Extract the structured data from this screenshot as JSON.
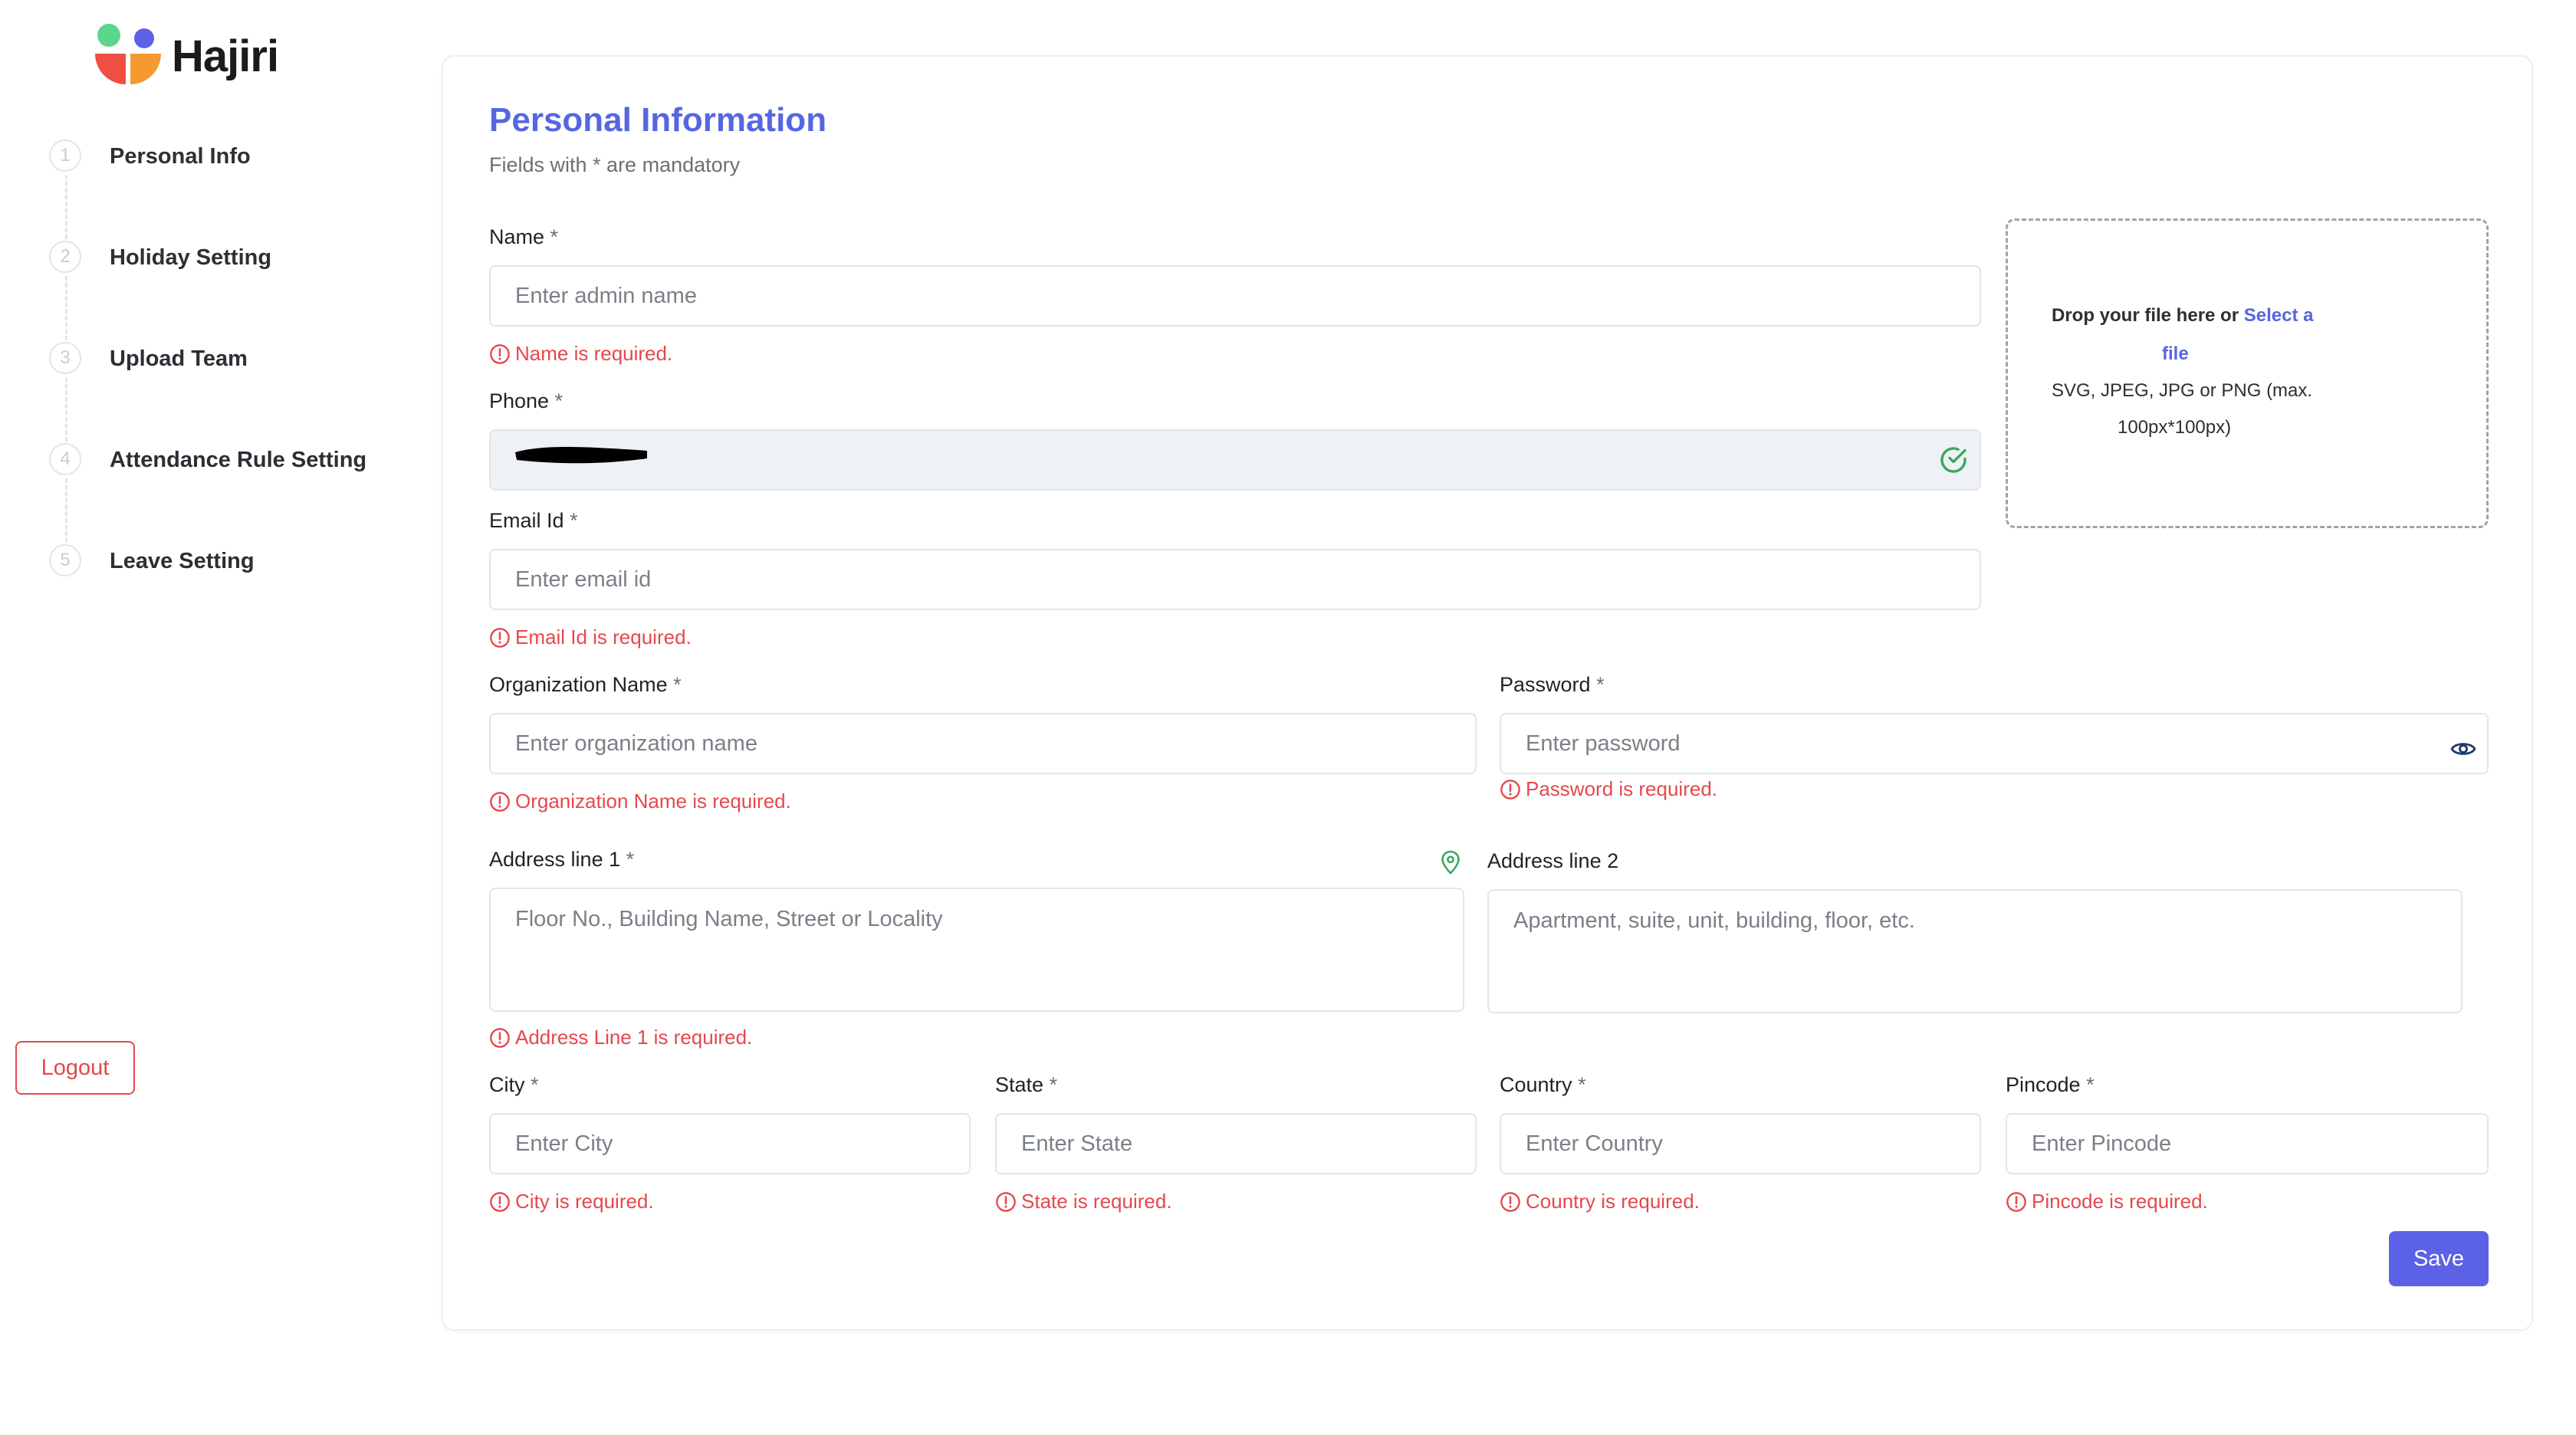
{
  "brand": {
    "name": "Hajiri",
    "colors": {
      "green": "#5bd68c",
      "purple": "#5b62e6",
      "red": "#ef4e43",
      "orange": "#f59a2e"
    }
  },
  "steps": [
    {
      "number": "1",
      "label": "Personal Info"
    },
    {
      "number": "2",
      "label": "Holiday Setting"
    },
    {
      "number": "3",
      "label": "Upload Team"
    },
    {
      "number": "4",
      "label": "Attendance Rule Setting"
    },
    {
      "number": "5",
      "label": "Leave Setting"
    }
  ],
  "logout_label": "Logout",
  "form": {
    "title": "Personal Information",
    "subtitle": "Fields with * are mandatory",
    "required_mark": "*",
    "name": {
      "label": "Name",
      "placeholder": "Enter admin name",
      "error": "Name is required."
    },
    "phone": {
      "label": "Phone",
      "value": ""
    },
    "email": {
      "label": "Email Id",
      "placeholder": "Enter email id",
      "error": "Email Id is required."
    },
    "organization": {
      "label": "Organization Name",
      "placeholder": "Enter organization name",
      "error": "Organization Name is required."
    },
    "password": {
      "label": "Password",
      "placeholder": "Enter password",
      "error": "Password is required."
    },
    "address1": {
      "label": "Address line 1",
      "placeholder": "Floor No., Building Name, Street or Locality",
      "error": "Address Line 1 is required."
    },
    "address2": {
      "label": "Address line 2",
      "placeholder": "Apartment, suite, unit, building, floor, etc."
    },
    "city": {
      "label": "City",
      "placeholder": "Enter City",
      "error": "City is required."
    },
    "state": {
      "label": "State",
      "placeholder": "Enter State",
      "error": "State is required."
    },
    "country": {
      "label": "Country",
      "placeholder": "Enter Country",
      "error": "Country is required."
    },
    "pincode": {
      "label": "Pincode",
      "placeholder": "Enter Pincode",
      "error": "Pincode is required."
    },
    "upload": {
      "prompt": "Drop your file here or",
      "link_part1": "Select a",
      "link_part2": "file",
      "formats": "SVG, JPEG, JPG or PNG (max.",
      "size": "100px*100px)"
    },
    "save_label": "Save"
  },
  "colors": {
    "accent": "#5567e0",
    "error": "#e5484d",
    "success": "#3aa55d"
  }
}
